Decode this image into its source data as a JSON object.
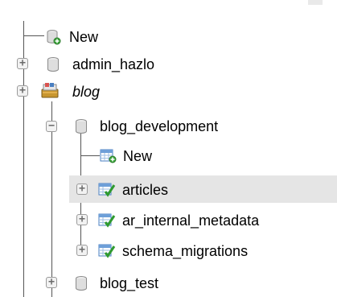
{
  "tree": {
    "new_db": {
      "label": "New"
    },
    "db_admin": {
      "label": "admin_hazlo"
    },
    "db_blog": {
      "label": "blog"
    },
    "db_blog_development": {
      "label": "blog_development"
    },
    "new_table": {
      "label": "New"
    },
    "tables": [
      {
        "label": "articles"
      },
      {
        "label": "ar_internal_metadata"
      },
      {
        "label": "schema_migrations"
      }
    ],
    "db_blog_test": {
      "label": "blog_test"
    }
  }
}
